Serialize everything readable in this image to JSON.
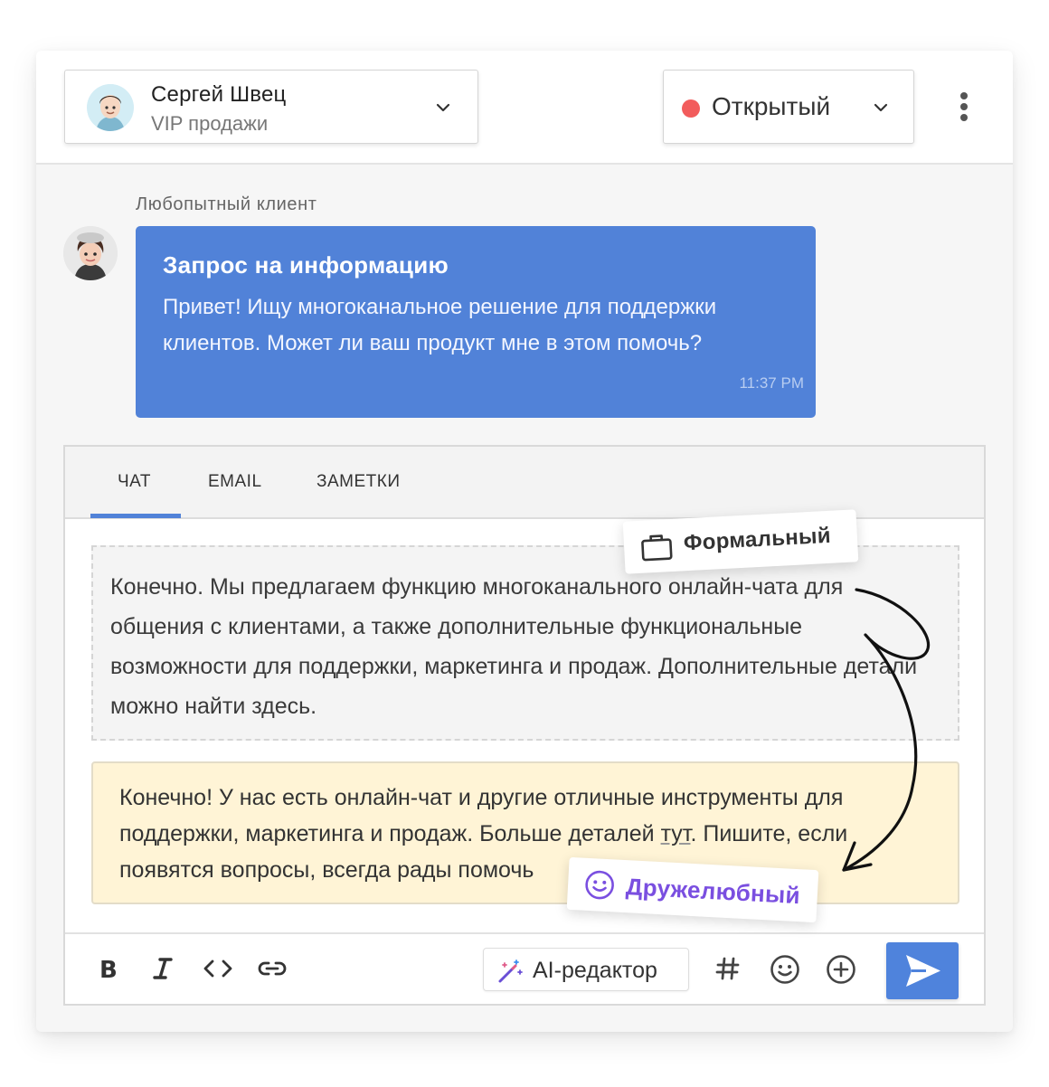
{
  "header": {
    "agent_name": "Сергей Швец",
    "agent_team": "VIP продажи",
    "status_label": "Открытый",
    "status_color": "#f25c5c"
  },
  "message": {
    "sender": "Любопытный клиент",
    "title": "Запрос на информацию",
    "text": "Привет! Ищу многоканальное решение для поддержки клиентов. Может ли ваш продукт мне в этом помочь?",
    "time": "11:37 PM",
    "bubble_color": "#5182d8"
  },
  "tabs": [
    {
      "label": "ЧАТ",
      "active": true
    },
    {
      "label": "EMAIL",
      "active": false
    },
    {
      "label": "ЗАМЕТКИ",
      "active": false
    }
  ],
  "formal": {
    "tag_label": "Формальный",
    "text": "Конечно. Мы предлагаем функцию многоканального онлайн-чата для общения с клиентами, а также дополнительные функциональные возможности для поддержки, маркетинга и продаж. Дополнительные детали можно найти здесь."
  },
  "friendly": {
    "tag_label": "Дружелюбный",
    "text_before": "Конечно! У нас есть онлайн-чат и другие отличные инструменты для поддержки, маркетинга и продаж. Больше деталей ",
    "link_text": "тут",
    "text_after": ". Пишите, если появятся вопросы, всегда рады помочь",
    "accent_color": "#7a4fe0"
  },
  "toolbar": {
    "ai_label": "AI-редактор",
    "icons": [
      "bold-icon",
      "italic-icon",
      "code-icon",
      "link-icon",
      "magic-wand-icon",
      "hashtag-icon",
      "emoji-icon",
      "add-circle-icon",
      "send-icon"
    ]
  }
}
